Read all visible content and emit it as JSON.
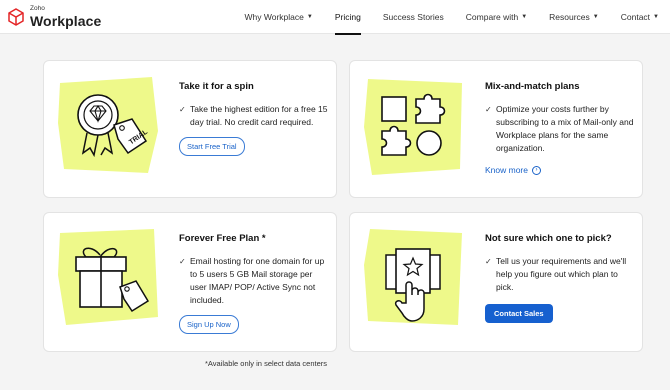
{
  "brand": {
    "small": "Zoho",
    "name": "Workplace",
    "accent": "#e42527"
  },
  "nav": [
    {
      "label": "Why Workplace",
      "dropdown": true
    },
    {
      "label": "Pricing",
      "dropdown": false,
      "active": true
    },
    {
      "label": "Success Stories",
      "dropdown": false
    },
    {
      "label": "Compare with",
      "dropdown": true
    },
    {
      "label": "Resources",
      "dropdown": true
    },
    {
      "label": "Contact",
      "dropdown": true
    }
  ],
  "cards": {
    "trial": {
      "title": "Take it for a spin",
      "bullet": "Take the highest edition for a free 15 day trial. No credit card required.",
      "button": "Start Free Trial",
      "tag_text": "TRIAL"
    },
    "mix": {
      "title": "Mix-and-match plans",
      "bullet": "Optimize your costs further by subscribing to a mix of Mail-only and Workplace plans for the same organization.",
      "link": "Know more"
    },
    "free": {
      "title": "Forever Free Plan *",
      "bullet": "Email hosting for one domain for up to 5 users 5 GB Mail storage per user IMAP/ POP/ Active Sync not included.",
      "button": "Sign Up Now"
    },
    "pick": {
      "title": "Not sure which one to pick?",
      "bullet": "Tell us your requirements and we'll help you figure out which plan to pick.",
      "button": "Contact Sales"
    }
  },
  "footnote": "*Available only in select data centers",
  "colors": {
    "highlight": "#eef98a",
    "link": "#1a63c9",
    "button": "#1660cf"
  }
}
